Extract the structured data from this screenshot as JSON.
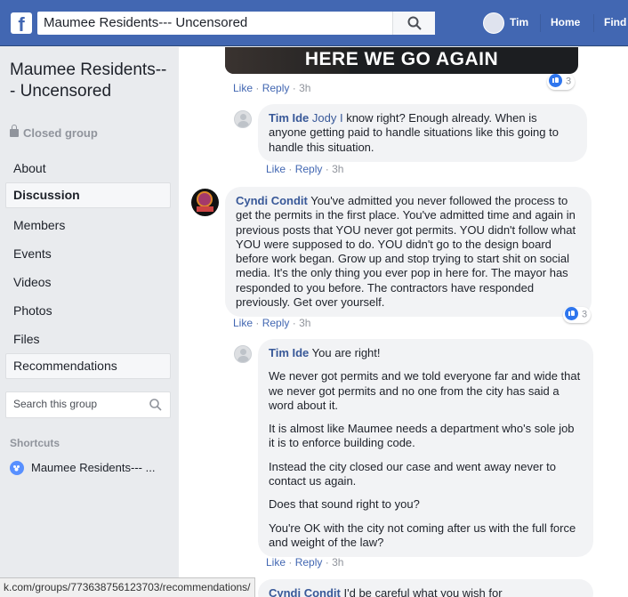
{
  "topbar": {
    "logo": "f",
    "search_value": "Maumee Residents--- Uncensored",
    "user_name": "Tim",
    "home_label": "Home",
    "find_label": "Find"
  },
  "sidebar": {
    "group_title": "Maumee Residents--- Uncensored",
    "privacy": "Closed group",
    "nav": [
      "About",
      "Discussion",
      "Members",
      "Events",
      "Videos",
      "Photos",
      "Files",
      "Recommendations"
    ],
    "search_placeholder": "Search this group",
    "shortcuts_heading": "Shortcuts",
    "shortcut_item": "Maumee Residents--- ..."
  },
  "status_url": "k.com/groups/773638756123703/recommendations/",
  "feed": {
    "video_caption": "HERE WE GO AGAIN",
    "post_actions": {
      "like": "Like",
      "reply": "Reply",
      "time": "3h",
      "reactions": "3"
    },
    "comments": [
      {
        "author": "Tim Ide",
        "tag": "Jody I",
        "text": " know right? Enough already. When is anyone getting paid to handle situations like this going to handle this situation.",
        "like": "Like",
        "reply": "Reply",
        "time": "3h"
      },
      {
        "author": "Cyndi Condit",
        "text": " You've admitted you never followed the process to get the permits in the first place. You've admitted time and again in previous posts that YOU never got permits. YOU didn't follow what YOU were supposed to do. YOU didn't go to the design board before work began. Grow up and stop trying to start shit on social media. It's the only thing you ever pop in here for. The mayor has responded to you before. The contractors have responded previously. Get over yourself.",
        "like": "Like",
        "reply": "Reply",
        "time": "3h",
        "reactions": "3"
      },
      {
        "author": "Tim Ide",
        "first_line": " You are right!",
        "paragraphs": [
          "We never got permits and we told everyone far and wide that we never got permits and no one from the city has said a word about it.",
          "It is almost like Maumee needs a department who's sole job it is to enforce building code.",
          "Instead the city closed our case and went away never to contact us again.",
          "Does that sound right to you?",
          "You're OK with the city not coming after us with the full force and weight of the law?"
        ],
        "like": "Like",
        "reply": "Reply",
        "time": "3h"
      },
      {
        "author": "Cyndi Condit",
        "text": " I'd be careful what you wish for"
      }
    ]
  }
}
